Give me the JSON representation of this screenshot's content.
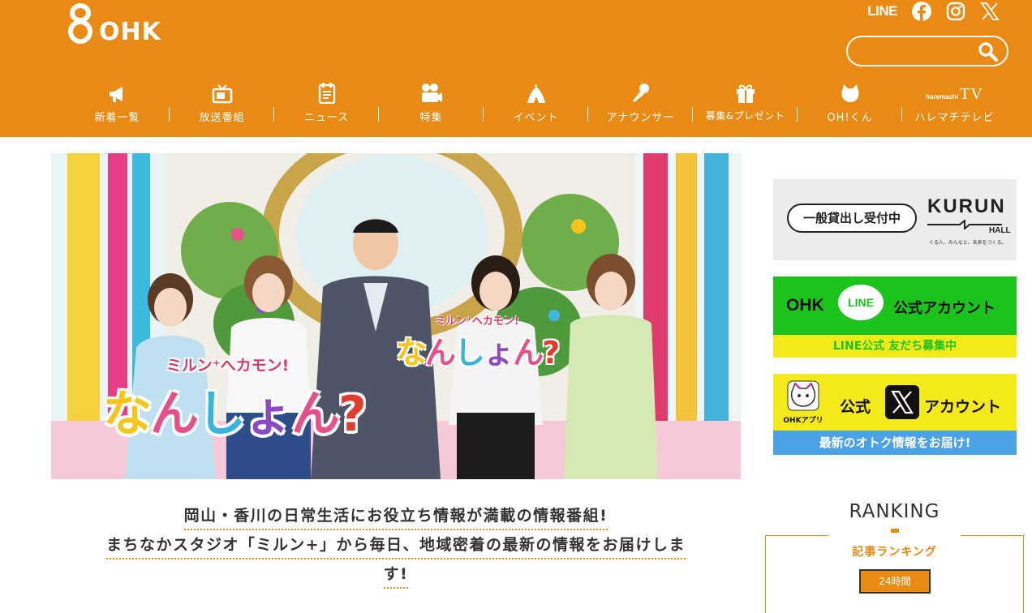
{
  "logo": {
    "number": "8",
    "text": "OHK"
  },
  "social": {
    "line": "LINE",
    "facebook": "facebook-icon",
    "instagram": "instagram-icon",
    "x": "x-icon"
  },
  "search": {
    "value": "",
    "placeholder": ""
  },
  "nav": [
    {
      "label": "新着一覧",
      "icon": "megaphone-icon"
    },
    {
      "label": "放送番組",
      "icon": "tv-icon"
    },
    {
      "label": "ニュース",
      "icon": "document-icon"
    },
    {
      "label": "特集",
      "icon": "camera-icon"
    },
    {
      "label": "イベント",
      "icon": "tent-icon"
    },
    {
      "label": "アナウンサー",
      "icon": "microphone-icon"
    },
    {
      "label": "募集&プレゼント",
      "icon": "gift-icon"
    },
    {
      "label": "OH!くん",
      "icon": "mascot-icon"
    },
    {
      "label": "ハレマチテレビ",
      "icon": "haremachi-tv-logo",
      "logo_small": "haremachi",
      "logo_big": "TV"
    }
  ],
  "hero": {
    "logo_small": "ミルン⁺へカモン!",
    "logo_big": [
      "な",
      "ん",
      "し",
      "ょ",
      "ん",
      "?"
    ]
  },
  "description": {
    "lines": [
      "岡山・香川の日常生活にお役立ち情報が満載の情報番組!",
      "まちなかスタジオ「ミルン+」から毎日、地域密着の最新の情報をお届けしま",
      "す!"
    ]
  },
  "banners": {
    "kurun": {
      "pill": "一般貸出し受付中",
      "logo": "KURUN",
      "hall": "HALL",
      "tagline": "くる人、みんなと、未来をつくる。"
    },
    "line": {
      "ohk": "OHK",
      "bubble": "LINE",
      "official": "公式アカウント",
      "footer": "LINE公式 友だち募集中"
    },
    "x": {
      "app": "OHKアプリ",
      "kou": "公式",
      "account": "アカウント",
      "footer": "最新のオトク情報をお届け!"
    }
  },
  "ranking": {
    "title": "RANKING",
    "subtitle": "記事ランキング",
    "tab": "24時間"
  },
  "colors": {
    "brand_orange": "#e88a13",
    "line_green": "#1dc31d",
    "yellow": "#f4ea19",
    "x_blue": "#4aa1e6"
  }
}
